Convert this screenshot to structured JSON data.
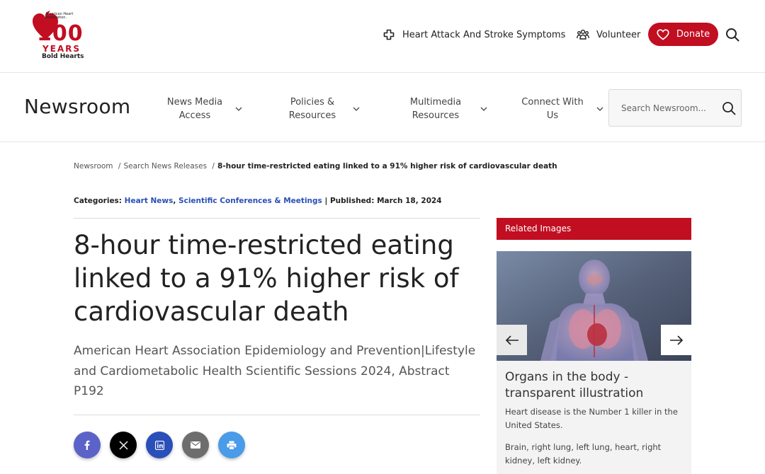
{
  "header": {
    "logo": {
      "org_text": "American Heart Association.",
      "hundred": "100",
      "years": "YEARS",
      "tagline": "Bold Hearts"
    },
    "symptoms_label": "Heart Attack And Stroke Symptoms",
    "volunteer_label": "Volunteer",
    "donate_label": "Donate"
  },
  "nav": {
    "title": "Newsroom",
    "items": [
      {
        "label": "News Media Access"
      },
      {
        "label": "Policies & Resources"
      },
      {
        "label": "Multimedia Resources"
      },
      {
        "label": "Connect With Us"
      }
    ],
    "search_placeholder": "Search Newsroom..."
  },
  "breadcrumb": {
    "items": [
      "Newsroom",
      "Search News Releases"
    ],
    "current": "8-hour time-restricted eating linked to a 91% higher risk of cardiovascular death"
  },
  "meta": {
    "categories_label": "Categories:",
    "categories": [
      "Heart News",
      "Scientific Conferences & Meetings"
    ],
    "published_label": "Published:",
    "published_date": "March 18, 2024"
  },
  "article": {
    "headline": "8-hour time-restricted eating linked to a 91% higher risk of cardiovascular death",
    "subhead": "American Heart Association Epidemiology and Prevention|Lifestyle and Cardiometabolic Health Scientific Sessions 2024, Abstract P192"
  },
  "share": {
    "icons": [
      "facebook-icon",
      "x-icon",
      "linkedin-icon",
      "email-icon",
      "print-icon"
    ]
  },
  "related": {
    "header": "Related Images",
    "title": "Organs in the body - transparent illustration",
    "description": "Heart disease is the Number 1 killer in the United States.",
    "description_2": "Brain, right lung, left lung, heart, right kidney, left kidney."
  },
  "colors": {
    "brand_red": "#c10e21",
    "link_blue": "#2a4fb8"
  }
}
